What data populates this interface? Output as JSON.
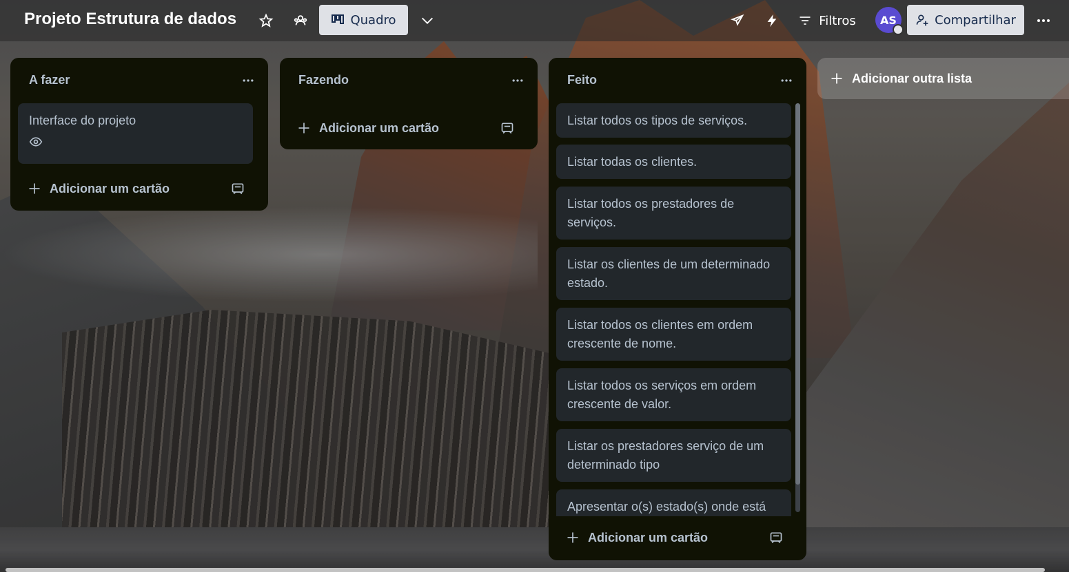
{
  "board": {
    "title": "Projeto Estrutura de dados",
    "view_label": "Quadro",
    "filters_label": "Filtros",
    "avatar_initials": "AS",
    "share_label": "Compartilhar",
    "add_list_label": "Adicionar outra lista"
  },
  "lists": [
    {
      "title": "A fazer",
      "cards": [
        {
          "text": "Interface do projeto",
          "watched": true
        }
      ],
      "add_card_label": "Adicionar um cartão"
    },
    {
      "title": "Fazendo",
      "cards": [],
      "add_card_label": "Adicionar um cartão"
    },
    {
      "title": "Feito",
      "cards": [
        {
          "text": "Listar todos os tipos de serviços."
        },
        {
          "text": "Listar todas os clientes."
        },
        {
          "text": "Listar todos os prestadores de serviços."
        },
        {
          "text": "Listar os clientes de um determinado estado."
        },
        {
          "text": "Listar todos os clientes em ordem crescente de nome."
        },
        {
          "text": "Listar todos os serviços em ordem crescente de valor."
        },
        {
          "text": "Listar os prestadores serviço de um determinado tipo"
        },
        {
          "text": "Apresentar o(s) estado(s) onde está"
        }
      ],
      "add_card_label": "Adicionar um cartão"
    }
  ],
  "icons": {
    "star": "star-icon",
    "people": "people-icon",
    "view": "board-view-icon",
    "chevron": "chevron-down-icon",
    "rocket": "rocket-icon",
    "bolt": "bolt-icon",
    "filter": "filter-icon",
    "share": "share-icon",
    "more": "more-icon",
    "template": "card-template-icon",
    "eye": "eye-icon",
    "plus": "plus-icon"
  },
  "colors": {
    "list_bg": "#101204",
    "card_bg": "#22272b",
    "text": "#b6c2cf",
    "avatar": "#5a4bd1",
    "button_bg": "#dfe1e6"
  }
}
